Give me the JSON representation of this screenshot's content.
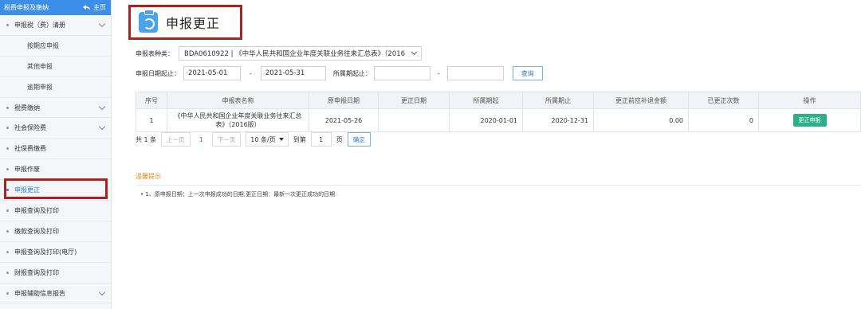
{
  "sidebar": {
    "header_title": "税费申报及缴纳",
    "home_label": "主页",
    "items": [
      {
        "label": "申报税（费）清册",
        "type": "group"
      },
      {
        "label": "按期应申报",
        "type": "sub"
      },
      {
        "label": "其他申报",
        "type": "sub"
      },
      {
        "label": "逾期申报",
        "type": "sub"
      },
      {
        "label": "税费缴纳",
        "type": "group"
      },
      {
        "label": "社会保险费",
        "type": "group"
      },
      {
        "label": "社保费缴费",
        "type": "item"
      },
      {
        "label": "申报作废",
        "type": "item"
      },
      {
        "label": "申报更正",
        "type": "item",
        "active": true
      },
      {
        "label": "申报查询及打印",
        "type": "item"
      },
      {
        "label": "缴款查询及打印",
        "type": "item"
      },
      {
        "label": "申报查询及打印(电厅)",
        "type": "item"
      },
      {
        "label": "财报查询及打印",
        "type": "item"
      },
      {
        "label": "申报辅助信息报告",
        "type": "group"
      }
    ]
  },
  "page": {
    "title": "申报更正"
  },
  "filters": {
    "type_label": "申报表种类：",
    "type_value": "BDA0610922 | 《中华人民共和国企业年度关联业务往来汇总表》（2016",
    "date_label": "申报日期起止：",
    "date_from": "2021-05-01",
    "date_sep": "-",
    "date_to": "2021-05-31",
    "period_label": "所属期起止：",
    "period_from": "",
    "period_sep": "-",
    "period_to": "",
    "query_button": "查询"
  },
  "table": {
    "headers": [
      "序号",
      "申报表名称",
      "原申报日期",
      "更正日期",
      "所属期起",
      "所属期止",
      "更正前应补退金额",
      "已更正次数",
      "操作"
    ],
    "rows": [
      {
        "index": "1",
        "name": "《中华人民共和国企业年度关联业务往来汇总表》（2016版）",
        "orig_date": "2021-05-26",
        "fix_date": "",
        "period_from": "2020-01-01",
        "period_to": "2020-12-31",
        "amount": "0.00",
        "count": "0",
        "action": "更正申报"
      }
    ]
  },
  "pager": {
    "total": "共 1 条",
    "prev": "上一页",
    "current": "1",
    "next": "下一页",
    "page_size": "10 条/页",
    "goto_prefix": "到第",
    "goto_value": "1",
    "goto_suffix": "页",
    "confirm": "确定"
  },
  "tips": {
    "title": "温馨提示",
    "text": "• 1、原申报日期：上一次申报成功的日期;更正日期：最新一次更正成功的日期"
  }
}
